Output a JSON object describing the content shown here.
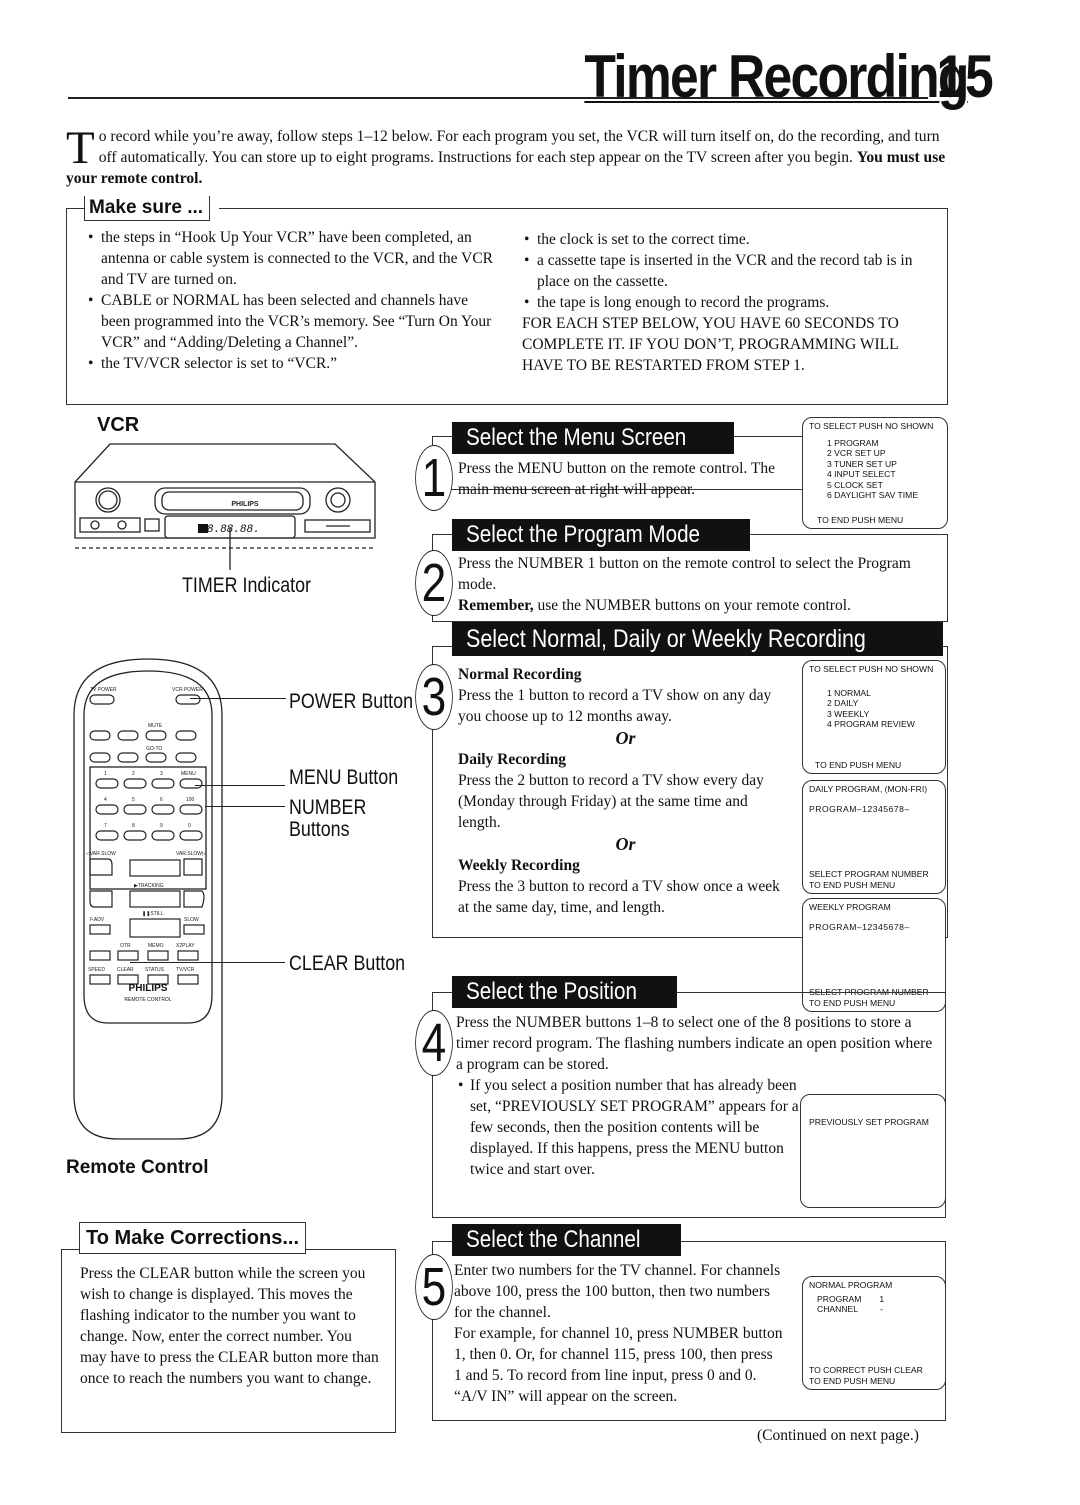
{
  "header": {
    "title": "Timer Recording",
    "page_number": "15"
  },
  "intro": {
    "drop_cap": "T",
    "text": "o record while you’re away, follow steps 1–12 below. For each program you set, the VCR will turn itself on, do the recording, and turn off automatically. You can store up to eight programs. Instructions for each step appear on the TV screen after you begin. ",
    "emphasis": "You must use your remote control."
  },
  "make_sure": {
    "label": "Make sure ...",
    "left_items": [
      "the steps in “Hook Up Your VCR” have been completed, an antenna or cable system is connected to the VCR, and the VCR and TV are turned on.",
      "CABLE or NORMAL has been selected and channels have been programmed into the VCR’s memory. See “Turn On Your VCR” and “Adding/Deleting a Channel”.",
      "the TV/VCR selector is set to “VCR.”"
    ],
    "right_items": [
      "the clock is set to the correct time.",
      "a cassette tape is inserted in the VCR and the record tab is in place on the cassette.",
      "the tape is long enough to record the programs."
    ],
    "warning": "FOR EACH STEP BELOW, YOU HAVE 60 SECONDS TO COMPLETE IT. IF YOU DON’T, PROGRAMMING WILL HAVE TO BE RESTARTED FROM STEP 1."
  },
  "vcr": {
    "label": "VCR",
    "brand": "PHILIPS",
    "display": "18.88.88.",
    "timer_indicator_label": "TIMER Indicator"
  },
  "remote": {
    "label": "Remote Control",
    "brand": "PHILIPS",
    "subtitle": "REMOTE CONTROL",
    "button_labels": {
      "tv_power": "TV POWER",
      "vcr_power": "VCR POWER",
      "mute": "MUTE",
      "go_to": "GO-TO",
      "menu": "MENU",
      "hundred": "100",
      "var_slow_l": "◁VAR.SLOW",
      "var_slow_r": "VAR.SLOW▷",
      "tracking": "▶TRACKING",
      "f_adv": "F.ADV",
      "still": "❚❚STILL",
      "slow": "SLOW",
      "otr": "OTR",
      "memo": "MEMO",
      "x2play": "X2PLAY",
      "speed": "SPEED",
      "clear": "CLEAR",
      "status": "STATUS",
      "tv_vcr": "TV/VCR",
      "digits": [
        "1",
        "2",
        "3",
        "4",
        "5",
        "6",
        "7",
        "8",
        "9",
        "0"
      ]
    },
    "callouts": {
      "power": "POWER Button",
      "menu": "MENU Button",
      "number_line1": "NUMBER",
      "number_line2": "Buttons",
      "clear": "CLEAR Button"
    }
  },
  "steps": [
    {
      "number": "1",
      "title": "Select the Menu Screen",
      "text": "Press the MENU button on the remote control. The main menu screen at right will appear.",
      "screen": {
        "top": "TO SELECT PUSH NO  SHOWN",
        "items": [
          "1 PROGRAM",
          "2 VCR SET UP",
          "3 TUNER SET UP",
          "4 INPUT SELECT",
          "5 CLOCK SET",
          "6 DAYLIGHT SAV  TIME"
        ],
        "bottom": "TO END PUSH MENU"
      }
    },
    {
      "number": "2",
      "title": "Select the Program Mode",
      "text": "Press the NUMBER 1 button on the remote control to select the Program mode.",
      "remember_bold": "Remember,",
      "remember_text": " use the NUMBER buttons on your remote control."
    },
    {
      "number": "3",
      "title": "Select Normal, Daily or Weekly Recording",
      "normal_heading": "Normal Recording",
      "normal_text": "Press the 1 button to record a TV show on any day you choose up to 12 months away.",
      "or": "Or",
      "daily_heading": "Daily Recording",
      "daily_text": "Press the 2 button to record a TV show every day (Monday through Friday) at the same time and length.",
      "weekly_heading": "Weekly Recording",
      "weekly_text": "Press the 3 button to record a TV show once a week at the same day, time, and length.",
      "screens": [
        {
          "top": "TO SELECT PUSH NO  SHOWN",
          "items": [
            "1 NORMAL",
            "2 DAILY",
            "3 WEEKLY",
            "4 PROGRAM REVIEW"
          ],
          "bottom": "TO END PUSH MENU"
        },
        {
          "top": "DAILY PROGRAM, (MON-FRI)",
          "program_line": "PROGRAM–12345678–",
          "bottom_1": "SELECT PROGRAM NUMBER",
          "bottom_2": "TO END PUSH MENU"
        },
        {
          "top": "WEEKLY PROGRAM",
          "program_line": "PROGRAM–12345678–",
          "bottom_1": "SELECT PROGRAM NUMBER",
          "bottom_2": "TO END PUSH MENU"
        }
      ]
    },
    {
      "number": "4",
      "title": "Select the Position",
      "text": "Press the NUMBER buttons 1–8 to select one of the 8 positions to store a timer record program. The flashing numbers indicate an open position where a program can be stored.",
      "bullet": "If you select a position number that has already been set, “PREVIOUSLY SET PROGRAM” appears for a few seconds, then the position contents will be displayed. If this happens, press the MENU button twice and start over.",
      "screen": {
        "text": "PREVIOUSLY SET PROGRAM"
      }
    },
    {
      "number": "5",
      "title": "Select the Channel",
      "text": "Enter two numbers for the TV channel. For channels above 100, press the 100 button, then two numbers for the channel.",
      "example": "For example, for channel 10, press NUMBER button 1, then 0. Or, for channel 115, press 100, then press 1 and 5. To record from line input, press 0 and 0. “A/V IN” will appear on the screen.",
      "screen": {
        "top": "NORMAL PROGRAM",
        "program_label": "PROGRAM",
        "program_value": "1",
        "channel_label": "CHANNEL",
        "channel_value": "-",
        "bottom_1": "TO CORRECT PUSH CLEAR",
        "bottom_2": "TO END PUSH MENU"
      }
    }
  ],
  "corrections": {
    "label": "To Make Corrections...",
    "text": "Press the CLEAR button while the screen you wish to change is displayed. This moves the flashing indicator to the number you want to change. Now, enter the correct number. You may have to press the CLEAR button more than once to reach the numbers you want to change."
  },
  "footer": {
    "continued": "(Continued on next page.)"
  }
}
